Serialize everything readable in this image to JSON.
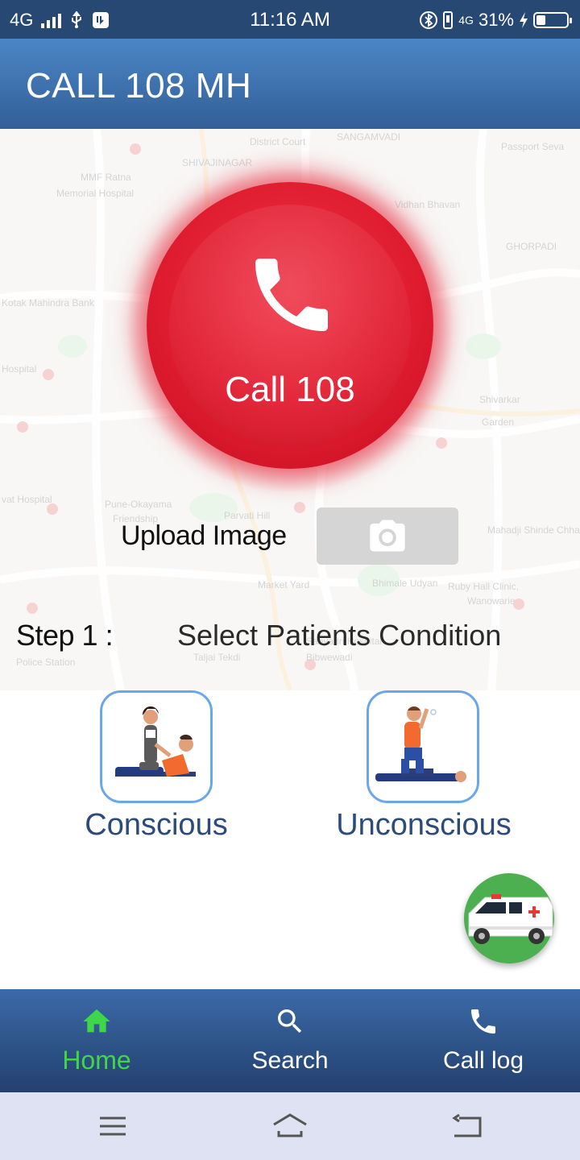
{
  "status_bar": {
    "network": "4G",
    "time": "11:16 AM",
    "network_right": "4G",
    "battery": "31%",
    "battery_level": 0.31
  },
  "app_bar": {
    "title": "CALL 108 MH"
  },
  "call_button": {
    "label": "Call 108",
    "icon": "phone-icon"
  },
  "upload": {
    "label": "Upload Image",
    "icon": "camera-icon"
  },
  "step": {
    "label": "Step 1 :",
    "text": "Select Patients Condition"
  },
  "conditions": [
    {
      "label": "Conscious",
      "icon": "conscious-patient-illustration"
    },
    {
      "label": "Unconscious",
      "icon": "unconscious-patient-illustration"
    }
  ],
  "fab": {
    "icon": "ambulance-icon"
  },
  "bottom_nav": [
    {
      "label": "Home",
      "icon": "home-icon",
      "active": true
    },
    {
      "label": "Search",
      "icon": "search-icon",
      "active": false
    },
    {
      "label": "Call log",
      "icon": "phone-icon",
      "active": false
    }
  ],
  "colors": {
    "status_bar": "#274872",
    "app_bar": "#4a86c7",
    "call_red": "#e01c30",
    "nav_active": "#3fd64a",
    "tile_border": "#6aa7ea",
    "condition_text": "#2c4a7a",
    "fab_green": "#4caf50"
  }
}
